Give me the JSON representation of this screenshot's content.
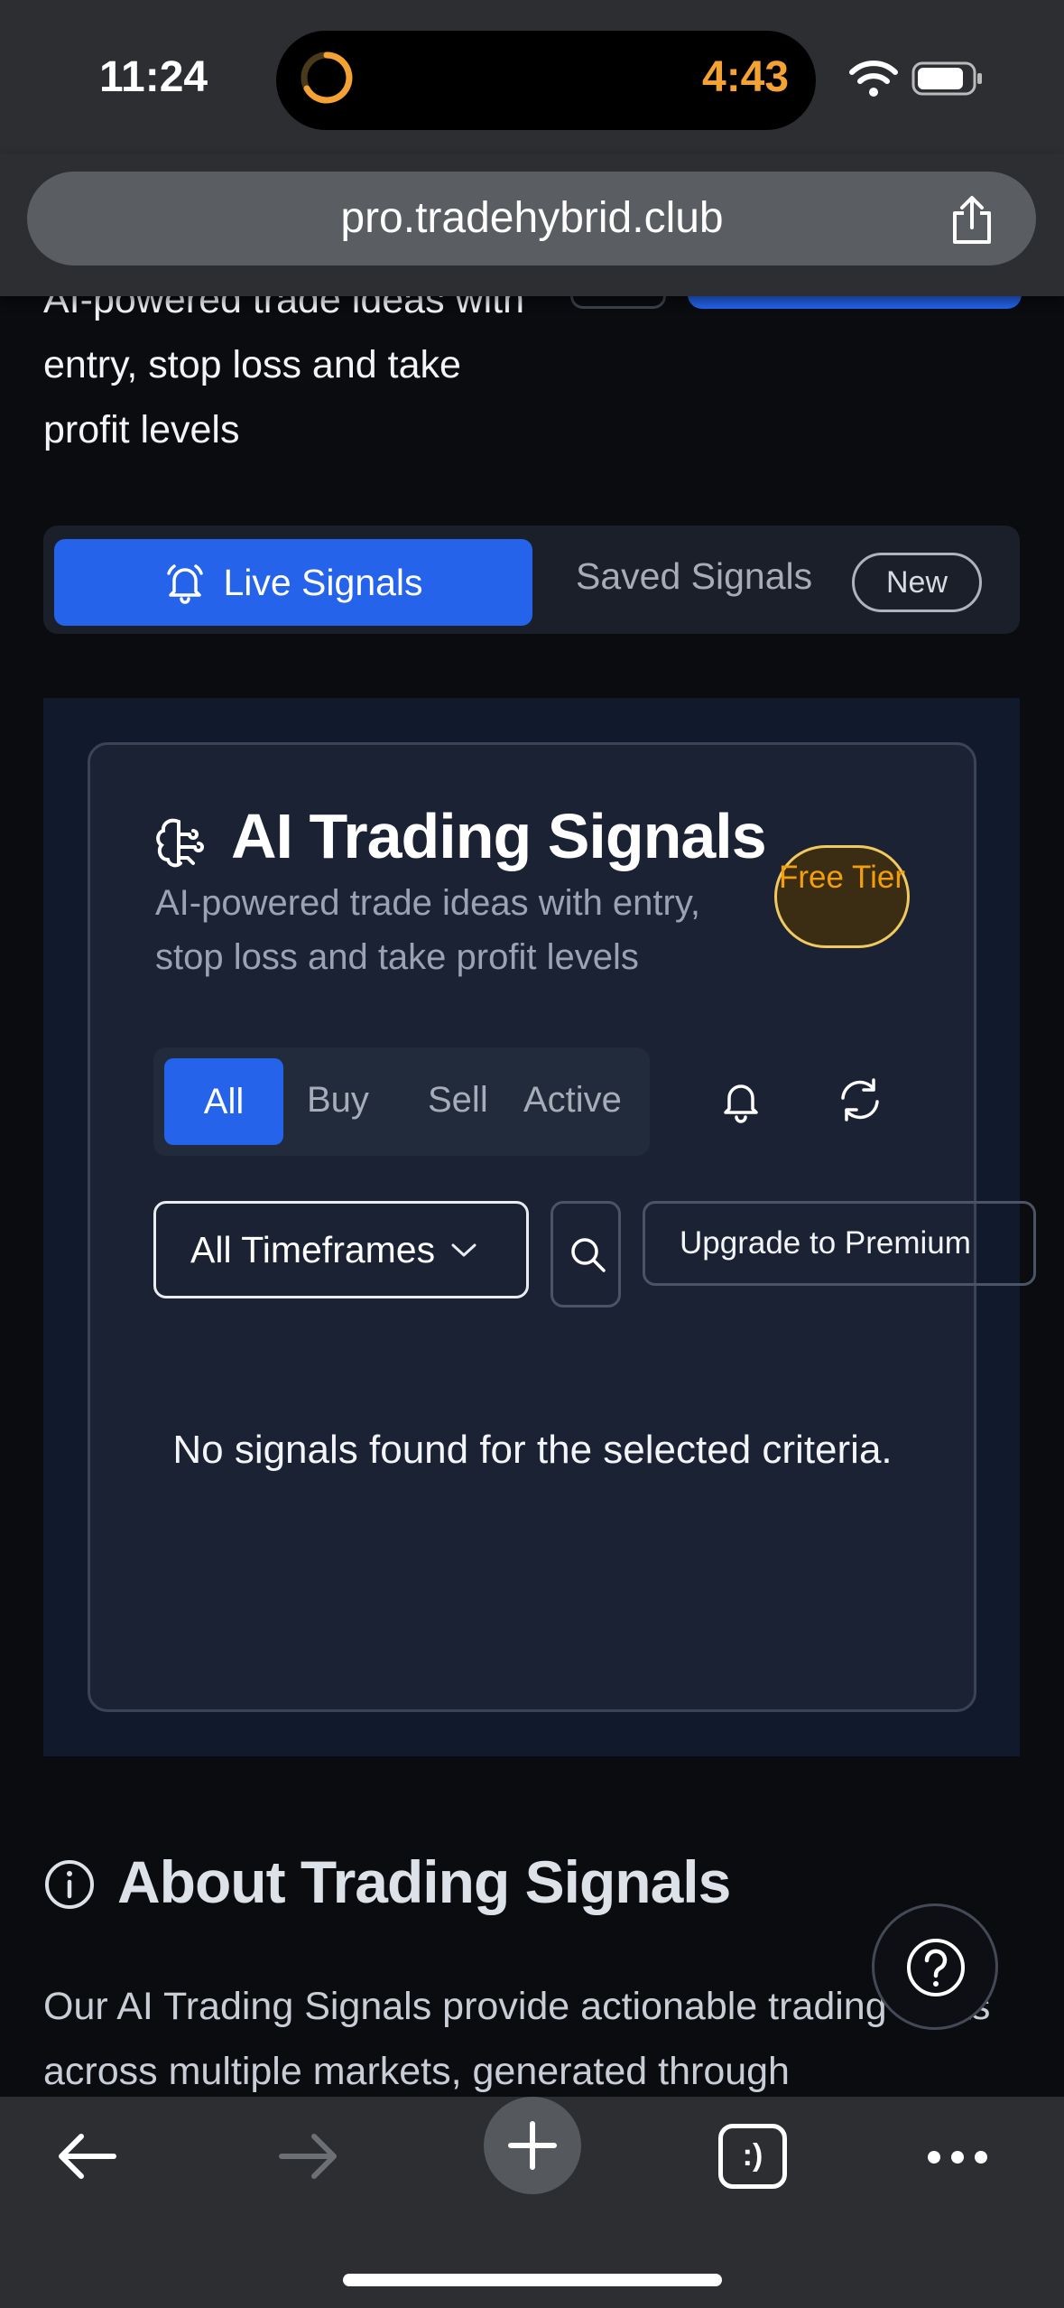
{
  "status_bar": {
    "time": "11:24",
    "timer": "4:43"
  },
  "browser": {
    "url": "pro.tradehybrid.club"
  },
  "header": {
    "intro_text": "AI-powered trade ideas with entry, stop loss and take profit levels"
  },
  "tabs": {
    "live_label": "Live Signals",
    "saved_label": "Saved Signals",
    "new_badge": "New"
  },
  "signals_card": {
    "title": "AI Trading Signals",
    "subtitle": "AI-powered trade ideas with entry, stop loss and take profit levels",
    "tier_badge": "Free Tier",
    "filters": [
      "All",
      "Buy",
      "Sell",
      "Active"
    ],
    "timeframe_select": "All Timeframes",
    "upgrade_label": "Upgrade to Premium",
    "empty_message": "No signals found for the selected criteria."
  },
  "about": {
    "title": "About Trading Signals",
    "text": "Our AI Trading Signals provide actionable trading ideas across multiple markets, generated through"
  },
  "toolbar": {
    "tabs_glyph": ":)"
  },
  "colors": {
    "accent": "#2563eb",
    "tier_text": "#f59e0b",
    "tier_border": "#f0c95f",
    "page_bg": "#0b0c10",
    "card_bg": "#1a2234"
  }
}
